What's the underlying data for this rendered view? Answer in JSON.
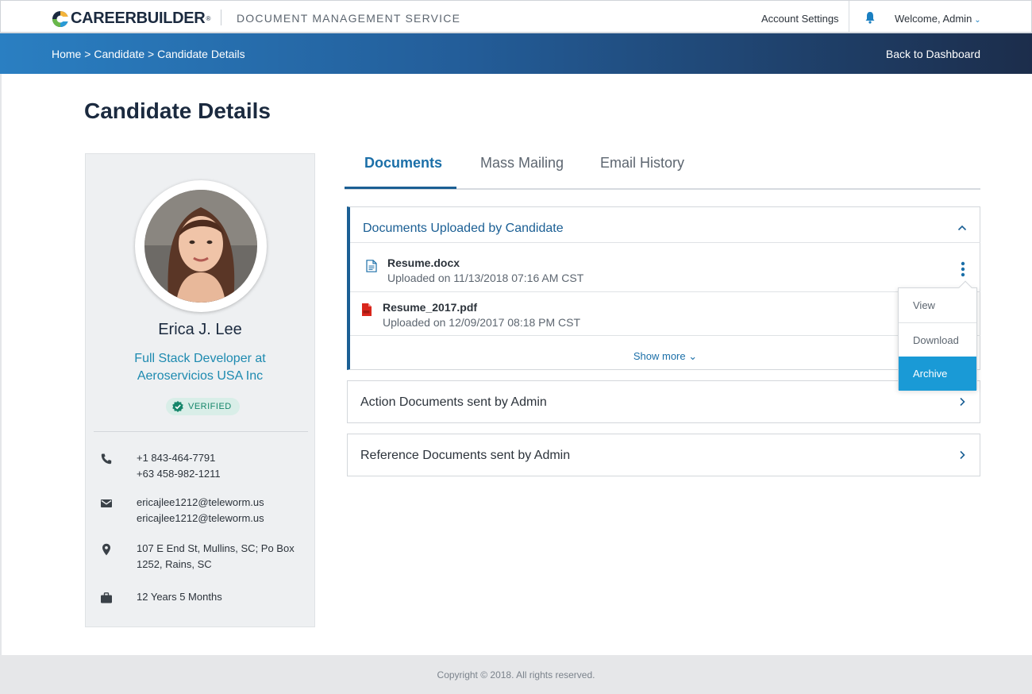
{
  "header": {
    "logo_text": "CAREERBUILDER",
    "logo_reg": "®",
    "service_title": "DOCUMENT MANAGEMENT SERVICE",
    "account_settings": "Account Settings",
    "welcome": "Welcome, Admin",
    "welcome_chevron": "⌄"
  },
  "breadcrumb": {
    "home": "Home",
    "sep1": " > ",
    "candidate": "Candidate",
    "sep2": " > ",
    "current": "Candidate Details",
    "back": "Back to Dashboard"
  },
  "page": {
    "title": "Candidate Details"
  },
  "profile": {
    "name": "Erica J. Lee",
    "title_line1": "Full Stack Developer at",
    "title_line2": "Aeroservicios USA Inc",
    "verified": "VERIFIED",
    "phone1": "+1 843-464-7791",
    "phone2": "+63 458-982-1211",
    "email1": "ericajlee1212@teleworm.us",
    "email2": "ericajlee1212@teleworm.us",
    "address_line1": "107 E End St, Mullins, SC; Po Box",
    "address_line2": "1252, Rains, SC",
    "experience": "12 Years 5 Months"
  },
  "tabs": [
    {
      "label": "Documents",
      "active": true
    },
    {
      "label": "Mass Mailing",
      "active": false
    },
    {
      "label": "Email History",
      "active": false
    }
  ],
  "sections": {
    "uploaded": {
      "title": "Documents Uploaded by Candidate",
      "documents": [
        {
          "name": "Resume.docx",
          "date": "Uploaded on 11/13/2018 07:16 AM CST",
          "icon": "doc-file-icon"
        },
        {
          "name": "Resume_2017.pdf",
          "date": "Uploaded on 12/09/2017 08:18 PM CST",
          "icon": "pdf-file-icon"
        }
      ],
      "show_more": "Show more ⌄"
    },
    "action": {
      "title": "Action Documents sent by Admin"
    },
    "reference": {
      "title": "Reference Documents sent by Admin"
    }
  },
  "context_menu": {
    "items": [
      "View",
      "Download",
      "Archive"
    ],
    "active": "Archive"
  },
  "footer": {
    "text": "Copyright © 2018. All rights reserved."
  },
  "colors": {
    "brand_dark": "#1b2a3f",
    "accent_blue": "#1b5f94",
    "link_teal": "#1d8ab0",
    "menu_active": "#1a9ad6",
    "verified_green": "#15866a"
  }
}
